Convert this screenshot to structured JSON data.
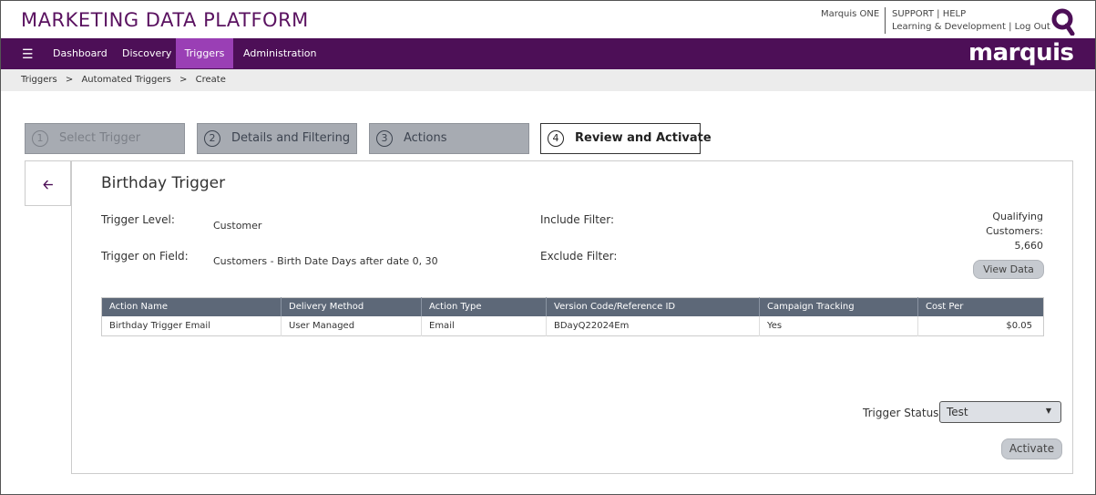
{
  "header": {
    "title": "MARKETING DATA PLATFORM",
    "user": "Marquis ONE",
    "links_top": [
      "SUPPORT",
      "HELP"
    ],
    "links_bottom": [
      "Learning & Development",
      "Log Out"
    ],
    "sep": "|"
  },
  "nav": {
    "items": [
      "Dashboard",
      "Discovery",
      "Triggers",
      "Administration"
    ],
    "active": "Triggers",
    "brand": "marquis"
  },
  "breadcrumb": [
    "Triggers",
    "Automated Triggers",
    "Create"
  ],
  "breadcrumb_sep": ">",
  "steps": [
    {
      "num": "1",
      "label": "Select Trigger",
      "state": "disabled"
    },
    {
      "num": "2",
      "label": "Details and Filtering",
      "state": "done"
    },
    {
      "num": "3",
      "label": "Actions",
      "state": "done"
    },
    {
      "num": "4",
      "label": "Review and Activate",
      "state": "current"
    }
  ],
  "review": {
    "title": "Birthday Trigger",
    "trigger_level_label": "Trigger Level:",
    "trigger_level_value": "Customer",
    "trigger_field_label": "Trigger on Field:",
    "trigger_field_value": "Customers - Birth Date Days after date 0, 30",
    "include_filter_label": "Include Filter:",
    "exclude_filter_label": "Exclude Filter:",
    "qualifying_line1": "Qualifying",
    "qualifying_line2": "Customers:",
    "qualifying_count": "5,660",
    "view_data_label": "View Data"
  },
  "table": {
    "columns": [
      "Action Name",
      "Delivery Method",
      "Action Type",
      "Version Code/Reference ID",
      "Campaign Tracking",
      "Cost Per"
    ],
    "rows": [
      [
        "Birthday Trigger Email",
        "User Managed",
        "Email",
        "BDayQ22024Em",
        "Yes",
        "$0.05"
      ]
    ]
  },
  "status": {
    "label": "Trigger Status:",
    "value": "Test"
  },
  "activate_label": "Activate",
  "colors": {
    "brand_purple": "#4d0f57",
    "active_tab": "#9a3fb5",
    "table_header": "#5d6878"
  },
  "icons": {
    "menu": "hamburger-icon",
    "back": "back-arrow-icon",
    "search_logo": "q-logo-icon",
    "dropdown": "caret-down-icon"
  }
}
